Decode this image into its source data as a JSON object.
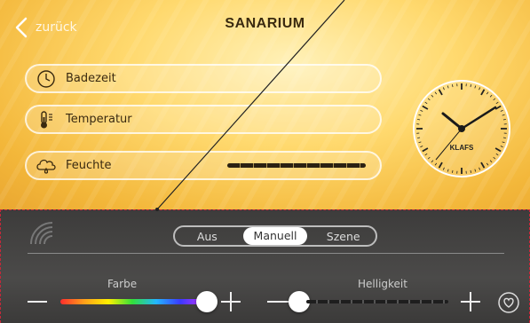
{
  "header": {
    "back_label": "zurück",
    "title": "SANARIUM"
  },
  "controls": [
    {
      "label": "Badezeit",
      "icon": "clock-icon"
    },
    {
      "label": "Temperatur",
      "icon": "thermometer-icon"
    },
    {
      "label": "Feuchte",
      "icon": "cloud-drop-icon"
    }
  ],
  "clock": {
    "brand": "KLAFS"
  },
  "light": {
    "modes": [
      "Aus",
      "Manuell",
      "Szene"
    ],
    "active_mode": "Manuell",
    "farbe_label": "Farbe",
    "helligkeit_label": "Helligkeit"
  },
  "colors": {
    "accent_red": "#c6283a",
    "panel_dark": "#444342"
  }
}
